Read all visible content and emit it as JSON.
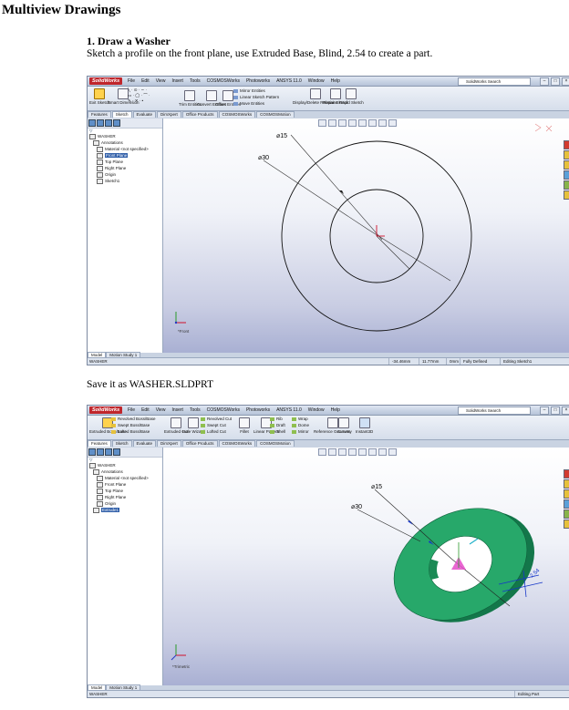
{
  "document": {
    "title": "Multiview Drawings",
    "step_heading": "1. Draw a Washer",
    "step_text": "Sketch a profile on the front plane, use Extruded Base, Blind, 2.54 to create a part.",
    "save_text": "Save it as WASHER.SLDPRT"
  },
  "screenshot1": {
    "app_logo": "SolidWorks",
    "menu": [
      "File",
      "Edit",
      "View",
      "Insert",
      "Tools",
      "COSMOSWorks",
      "Photoworks",
      "ANSYS 11.0",
      "Window",
      "Help"
    ],
    "search_placeholder": "SolidWorks Search",
    "ribbon": {
      "exit_sketch": "Exit Sketch",
      "smart_dimension": "Smart Dimension",
      "trim_entities": "Trim Entities",
      "convert_entities": "Convert Entities",
      "offset_entities": "Offset Entities",
      "mirror_entities": "Mirror Entities",
      "linear_sketch_pattern": "Linear Sketch Pattern",
      "move_entities": "Move Entities",
      "display_delete_relations": "Display/Delete Relations",
      "repair_sketch": "Repair Sketch",
      "rapid_sketch": "Rapid Sketch"
    },
    "tabs": [
      "Features",
      "Sketch",
      "Evaluate",
      "DimXpert",
      "Office Products",
      "COSMOSWorks",
      "COSMOSMotion"
    ],
    "active_tab": "Sketch",
    "tree": [
      {
        "label": "WASHER"
      },
      {
        "label": "Annotations"
      },
      {
        "label": "Material <not specified>"
      },
      {
        "label": "Front Plane",
        "selected": true
      },
      {
        "label": "Top Plane"
      },
      {
        "label": "Right Plane"
      },
      {
        "label": "Origin"
      },
      {
        "label": "Sketch1"
      }
    ],
    "dims": {
      "outer": "⌀15",
      "inner": "⌀30"
    },
    "view_label": "*Front",
    "bottom_tabs": [
      "Model",
      "Motion Study 1"
    ],
    "status": {
      "file": "WASHER",
      "x": "-34.46mm",
      "y": "11.77mm",
      "z": "0mm",
      "state": "Fully Defined",
      "editing": "Editing Sketch1"
    }
  },
  "screenshot2": {
    "app_logo": "SolidWorks",
    "menu": [
      "File",
      "Edit",
      "View",
      "Insert",
      "Tools",
      "COSMOSWorks",
      "Photoworks",
      "ANSYS 11.0",
      "Window",
      "Help"
    ],
    "search_placeholder": "SolidWorks Search",
    "ribbon": {
      "extruded_boss": "Extruded Boss/Base",
      "revolved_boss": "Revolved Boss/Base",
      "swept_boss": "Swept Boss/Base",
      "lofted_boss": "Lofted Boss/Base",
      "extruded_cut": "Extruded Cut",
      "hole_wizard": "Hole Wizard",
      "revolved_cut": "Revolved Cut",
      "swept_cut": "Swept Cut",
      "lofted_cut": "Lofted Cut",
      "fillet": "Fillet",
      "linear_pattern": "Linear Pattern",
      "rib": "Rib",
      "draft": "Draft",
      "shell": "Shell",
      "wrap": "Wrap",
      "dome": "Dome",
      "mirror": "Mirror",
      "reference_geometry": "Reference Geometry",
      "curves": "Curves",
      "instant3d": "Instant3D"
    },
    "tabs": [
      "Features",
      "Sketch",
      "Evaluate",
      "DimXpert",
      "Office Products",
      "COSMOSWorks",
      "COSMOSMotion"
    ],
    "active_tab": "Features",
    "tree": [
      {
        "label": "WASHER"
      },
      {
        "label": "Annotations"
      },
      {
        "label": "Material <not specified>"
      },
      {
        "label": "Front Plane"
      },
      {
        "label": "Top Plane"
      },
      {
        "label": "Right Plane"
      },
      {
        "label": "Origin"
      },
      {
        "label": "Extrude1",
        "selected": true
      }
    ],
    "dims": {
      "outer": "⌀15",
      "inner": "⌀30",
      "depth": "2.54"
    },
    "view_label": "*Trimetric",
    "bottom_tabs": [
      "Model",
      "Motion Study 1"
    ],
    "status": {
      "file": "WASHER",
      "editing": "Editing Part"
    },
    "colors": {
      "part": "#27a86a",
      "part_dark": "#13774a",
      "dim_arrow": "#1636c8"
    }
  }
}
